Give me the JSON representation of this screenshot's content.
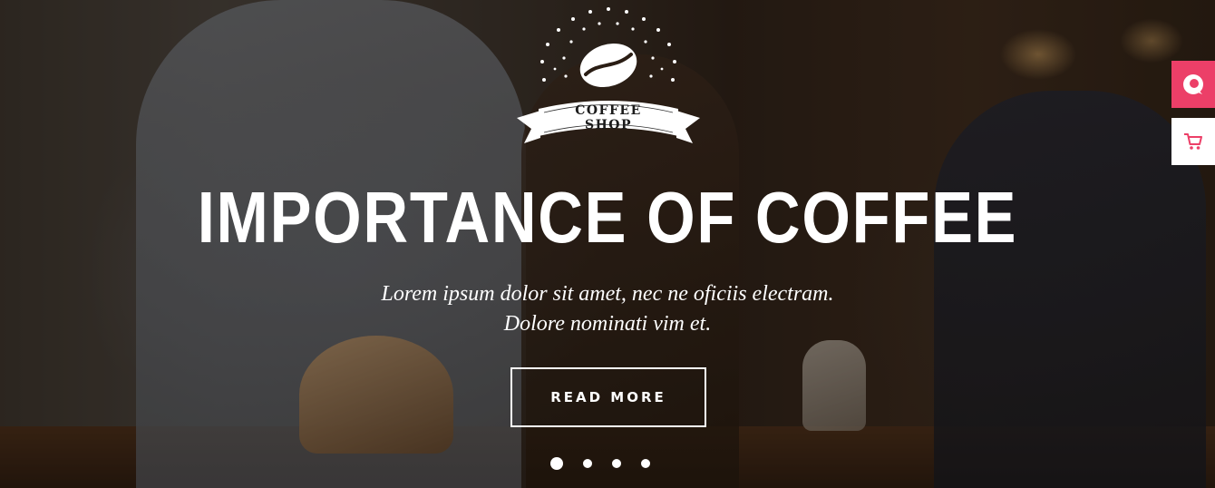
{
  "logo": {
    "text": "COFFEE SHOP"
  },
  "hero": {
    "title": "IMPORTANCE OF COFFEE",
    "subtitle_line1": "Lorem ipsum dolor sit amet, nec ne oficiis electram.",
    "subtitle_line2": "Dolore nominati vim et.",
    "button_label": "READ MORE"
  },
  "slider": {
    "total_slides": 4,
    "active_index": 1
  },
  "side_buttons": [
    {
      "icon": "brand-logo-icon",
      "color": "#ec3f68"
    },
    {
      "icon": "cart-icon",
      "color": "#ec3f68"
    }
  ],
  "colors": {
    "accent": "#ec3f68",
    "text": "#ffffff"
  }
}
